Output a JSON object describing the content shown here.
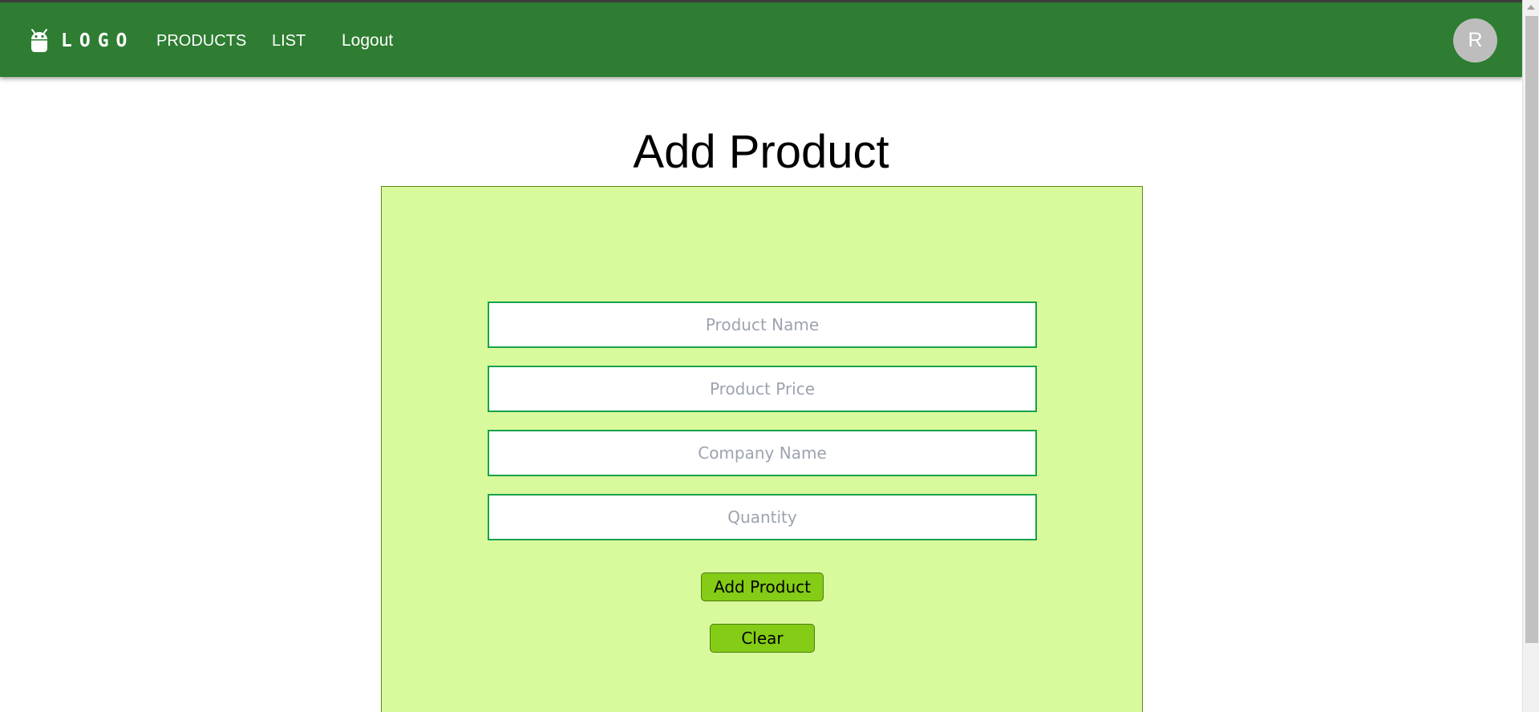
{
  "navbar": {
    "logo_icon": "android-icon",
    "logo_text": "LOGO",
    "links": [
      "PRODUCTS",
      "LIST",
      "Logout"
    ],
    "avatar_initial": "R",
    "colors": {
      "bar": "#2e7d32",
      "avatar": "#bdbdbd"
    }
  },
  "main": {
    "title": "Add Product",
    "form": {
      "fields": [
        {
          "name": "product-name",
          "placeholder": "Product Name",
          "value": ""
        },
        {
          "name": "product-price",
          "placeholder": "Product Price",
          "value": ""
        },
        {
          "name": "company-name",
          "placeholder": "Company Name",
          "value": ""
        },
        {
          "name": "quantity",
          "placeholder": "Quantity",
          "value": ""
        }
      ],
      "submit_label": "Add Product",
      "clear_label": "Clear",
      "colors": {
        "card": "#d9f99d",
        "field_border": "#16a34a",
        "button": "#84cc16"
      }
    }
  }
}
